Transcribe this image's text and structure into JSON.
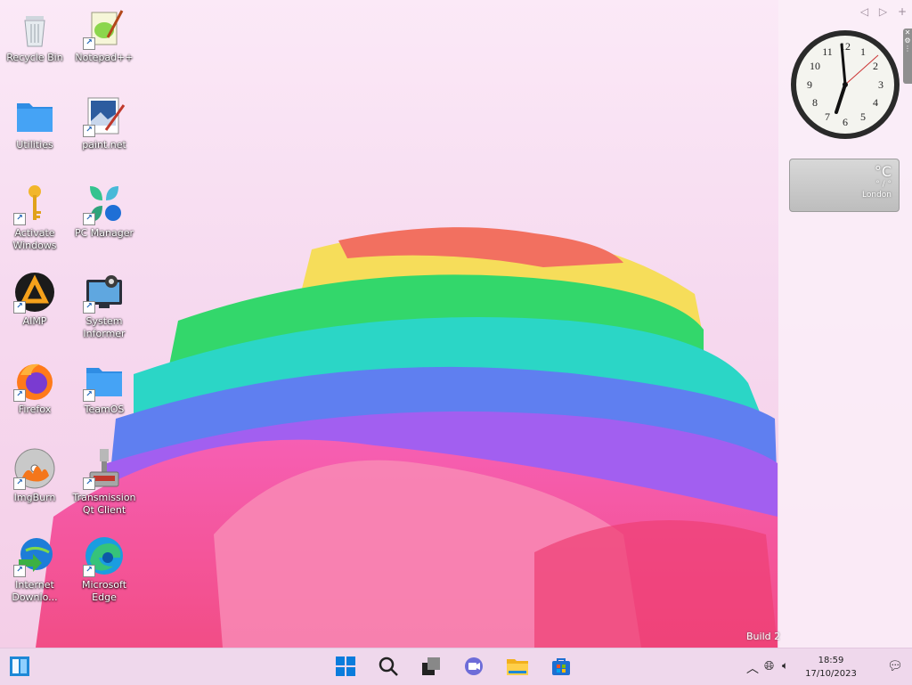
{
  "desktop": {
    "icons": [
      {
        "label": "Recycle Bin"
      },
      {
        "label": "Notepad++"
      },
      {
        "label": "Utilities"
      },
      {
        "label": "paint.net"
      },
      {
        "label": "Activate Windows"
      },
      {
        "label": "PC Manager"
      },
      {
        "label": "AIMP"
      },
      {
        "label": "System Informer"
      },
      {
        "label": "Firefox"
      },
      {
        "label": "TeamOS"
      },
      {
        "label": "ImgBurn"
      },
      {
        "label": "Transmission Qt Client"
      },
      {
        "label": "Internet Downlo..."
      },
      {
        "label": "Microsoft Edge"
      }
    ],
    "build_text": "Build 2"
  },
  "sidebar": {
    "controls": [
      "◁",
      "▷",
      "+"
    ],
    "clock": {
      "numbers": [
        "12",
        "1",
        "2",
        "3",
        "4",
        "5",
        "6",
        "7",
        "8",
        "9",
        "10",
        "11"
      ]
    },
    "weather": {
      "temp": "°C",
      "condition": "° / °",
      "city": "London"
    }
  },
  "taskbar": {
    "icons": [
      "start-icon",
      "search-icon",
      "task-view-icon",
      "chat-icon",
      "file-explorer-icon",
      "store-icon"
    ],
    "tray": {
      "time": "18:59",
      "date": "17/10/2023"
    }
  },
  "colors": {
    "taskbar_bg": "#efd8ec",
    "start_blue": "#0a7cdc"
  }
}
